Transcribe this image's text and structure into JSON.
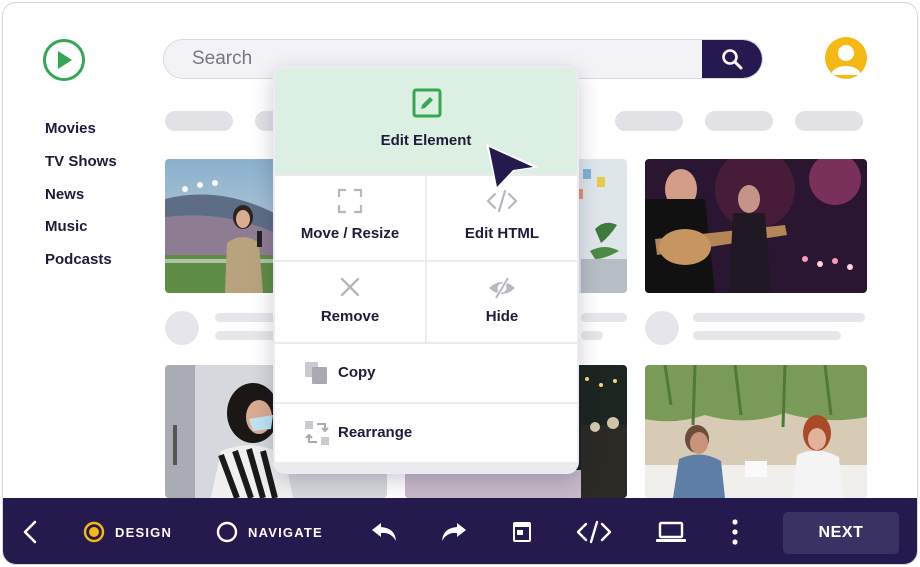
{
  "header": {
    "search_placeholder": "Search"
  },
  "sidebar": {
    "items": [
      {
        "label": "Movies"
      },
      {
        "label": "TV Shows"
      },
      {
        "label": "News"
      },
      {
        "label": "Music"
      },
      {
        "label": "Podcasts"
      }
    ]
  },
  "context_menu": {
    "edit_element": "Edit Element",
    "move_resize": "Move / Resize",
    "edit_html": "Edit HTML",
    "remove": "Remove",
    "hide": "Hide",
    "copy": "Copy",
    "rearrange": "Rearrange"
  },
  "toolbar": {
    "design_label": "DESIGN",
    "navigate_label": "NAVIGATE",
    "next_label": "NEXT",
    "mode_selected": "DESIGN"
  },
  "colors": {
    "brand_green": "#33a851",
    "toolbar_navy": "#241a4d",
    "accent_yellow": "#f5b915",
    "menu_highlight": "#dcefe3"
  },
  "icons": [
    "play-logo-icon",
    "search-icon",
    "user-avatar-icon",
    "pencil-edit-icon",
    "move-resize-icon",
    "code-icon",
    "close-x-icon",
    "eye-slash-icon",
    "copy-icon",
    "rearrange-icon",
    "pointer-cursor-icon",
    "chevron-left-icon",
    "undo-icon",
    "redo-icon",
    "browser-window-icon",
    "laptop-icon",
    "more-vertical-icon"
  ]
}
